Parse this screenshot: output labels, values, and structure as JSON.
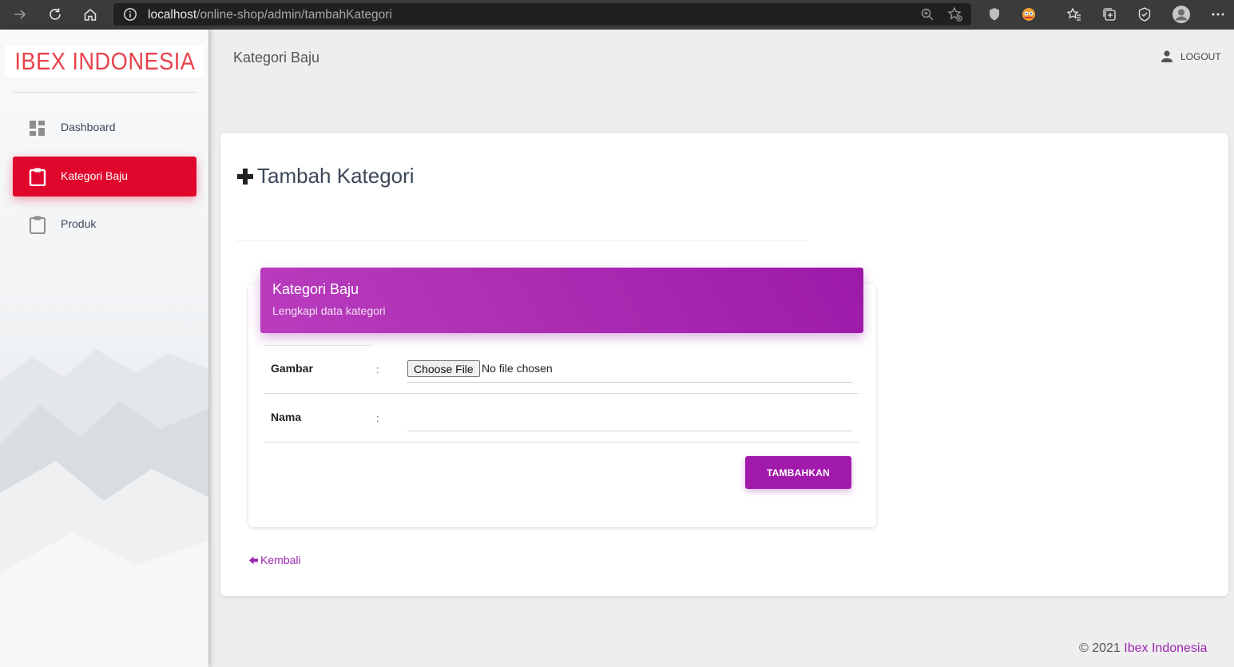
{
  "browser": {
    "url_host": "localhost",
    "url_path": "/online-shop/admin/tambahKategori"
  },
  "sidebar": {
    "logo": "IBEX INDONESIA",
    "items": [
      {
        "label": "Dashboard",
        "icon": "dashboard-icon",
        "active": false
      },
      {
        "label": "Kategori Baju",
        "icon": "clipboard-icon",
        "active": true
      },
      {
        "label": "Produk",
        "icon": "clipboard-icon",
        "active": false
      }
    ]
  },
  "header": {
    "title": "Kategori Baju",
    "logout_label": "LOGOUT"
  },
  "content": {
    "title": "Tambah Kategori",
    "form": {
      "header_title": "Kategori Baju",
      "header_subtitle": "Lengkapi data kategori",
      "gambar_label": "Gambar",
      "nama_label": "Nama",
      "colon": ":",
      "file_button_label": "Choose File",
      "file_status": "No file chosen",
      "nama_value": "",
      "submit_label": "TAMBAHKAN"
    },
    "back_label": "Kembali"
  },
  "footer": {
    "copyright": "© 2021",
    "brand": "Ibex Indonesia"
  },
  "colors": {
    "accent_red": "#e0062c",
    "accent_purple": "#9c27b0",
    "logo_red": "#e8424c"
  }
}
